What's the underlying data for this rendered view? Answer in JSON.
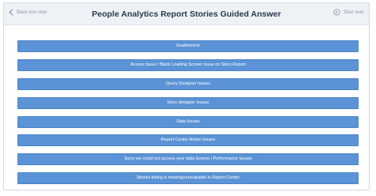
{
  "header": {
    "back_label": "Back one step",
    "title": "People Analytics Report Stories Guided Answer",
    "start_over_label": "Start over"
  },
  "options": [
    {
      "label": "Enablement"
    },
    {
      "label": "Access Issue / Blank Loading Screen Issue on Story Report"
    },
    {
      "label": "Query Designer Issues"
    },
    {
      "label": "Story designer Issues"
    },
    {
      "label": "Data Issues"
    },
    {
      "label": "Report Center Action Issues"
    },
    {
      "label": "Sorry we could not access your data Source / Performance Issues"
    },
    {
      "label": "Stories listing is missing/unavailable in Report Center"
    }
  ],
  "colors": {
    "option_button": "#5b93d6",
    "header_bg": "#eef2f7",
    "title_text": "#2b3a4c"
  }
}
